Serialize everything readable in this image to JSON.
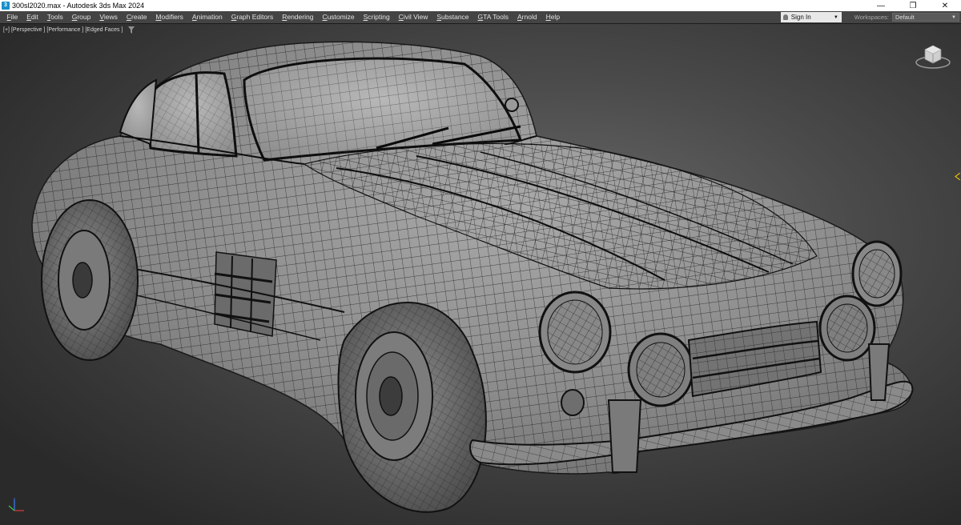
{
  "titlebar": {
    "app_icon_text": "3",
    "title": "300sl2020.max - Autodesk 3ds Max 2024",
    "controls": {
      "minimize": "—",
      "restore": "❐",
      "close": "✕"
    }
  },
  "menubar": {
    "items": [
      "File",
      "Edit",
      "Tools",
      "Group",
      "Views",
      "Create",
      "Modifiers",
      "Animation",
      "Graph Editors",
      "Rendering",
      "Customize",
      "Scripting",
      "Civil View",
      "Substance",
      "GTA Tools",
      "Arnold",
      "Help"
    ],
    "sign_in": "Sign In",
    "workspaces_label": "Workspaces:",
    "workspace_value": "Default"
  },
  "viewport": {
    "labels": [
      "[+]",
      "[Perspective ]",
      "[Performance ]",
      "[Edged Faces ]"
    ],
    "background_color": "#555555",
    "mesh_color": "#111111",
    "surface_color": "#8c8c8c"
  },
  "icons": {
    "filter": "filter-icon",
    "viewcube": "viewcube-icon",
    "axis": "axis-tripod-icon",
    "marker": "timeline-marker-icon"
  }
}
